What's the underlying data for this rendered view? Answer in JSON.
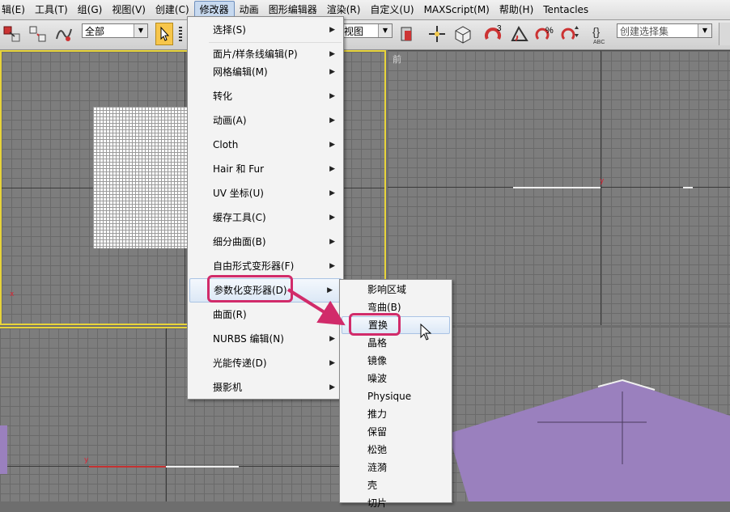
{
  "menubar": {
    "items": [
      "辑(E)",
      "工具(T)",
      "组(G)",
      "视图(V)",
      "创建(C)",
      "修改器",
      "动画",
      "图形编辑器",
      "渲染(R)",
      "自定义(U)",
      "MAXScript(M)",
      "帮助(H)",
      "Tentacles"
    ]
  },
  "toolbar": {
    "filter_select": "全部",
    "view_select": "视图",
    "named_selection": "创建选择集",
    "snap_label": "3",
    "abc_label": "ABC"
  },
  "viewports": {
    "front_label": "前"
  },
  "modify_menu": {
    "items": [
      {
        "label": "选择(S)",
        "arrow": "▶"
      },
      {
        "label": "面片/样条线编辑(P)",
        "arrow": "▶"
      },
      {
        "label": "网格编辑(M)",
        "arrow": "▶"
      },
      {
        "label": "转化",
        "arrow": "▶"
      },
      {
        "label": "动画(A)",
        "arrow": "▶"
      },
      {
        "label": "Cloth",
        "arrow": "▶"
      },
      {
        "label": "Hair 和 Fur",
        "arrow": "▶"
      },
      {
        "label": "UV 坐标(U)",
        "arrow": "▶"
      },
      {
        "label": "缓存工具(C)",
        "arrow": "▶"
      },
      {
        "label": "细分曲面(B)",
        "arrow": "▶"
      },
      {
        "label": "自由形式变形器(F)",
        "arrow": "▶"
      },
      {
        "label": "参数化变形器(D)",
        "arrow": "▶"
      },
      {
        "label": "曲面(R)",
        "arrow": "▶"
      },
      {
        "label": "NURBS 编辑(N)",
        "arrow": "▶"
      },
      {
        "label": "光能传递(D)",
        "arrow": "▶"
      },
      {
        "label": "摄影机",
        "arrow": "▶"
      }
    ]
  },
  "param_submenu": {
    "items": [
      "影响区域",
      "弯曲(B)",
      "置换",
      "晶格",
      "镜像",
      "噪波",
      "Physique",
      "推力",
      "保留",
      "松弛",
      "涟漪",
      "壳",
      "切片"
    ]
  },
  "colors": {
    "accent_highlight": "#d12b6a",
    "viewport_border_active": "#e8d43a",
    "purple_plane": "#9a80be"
  }
}
